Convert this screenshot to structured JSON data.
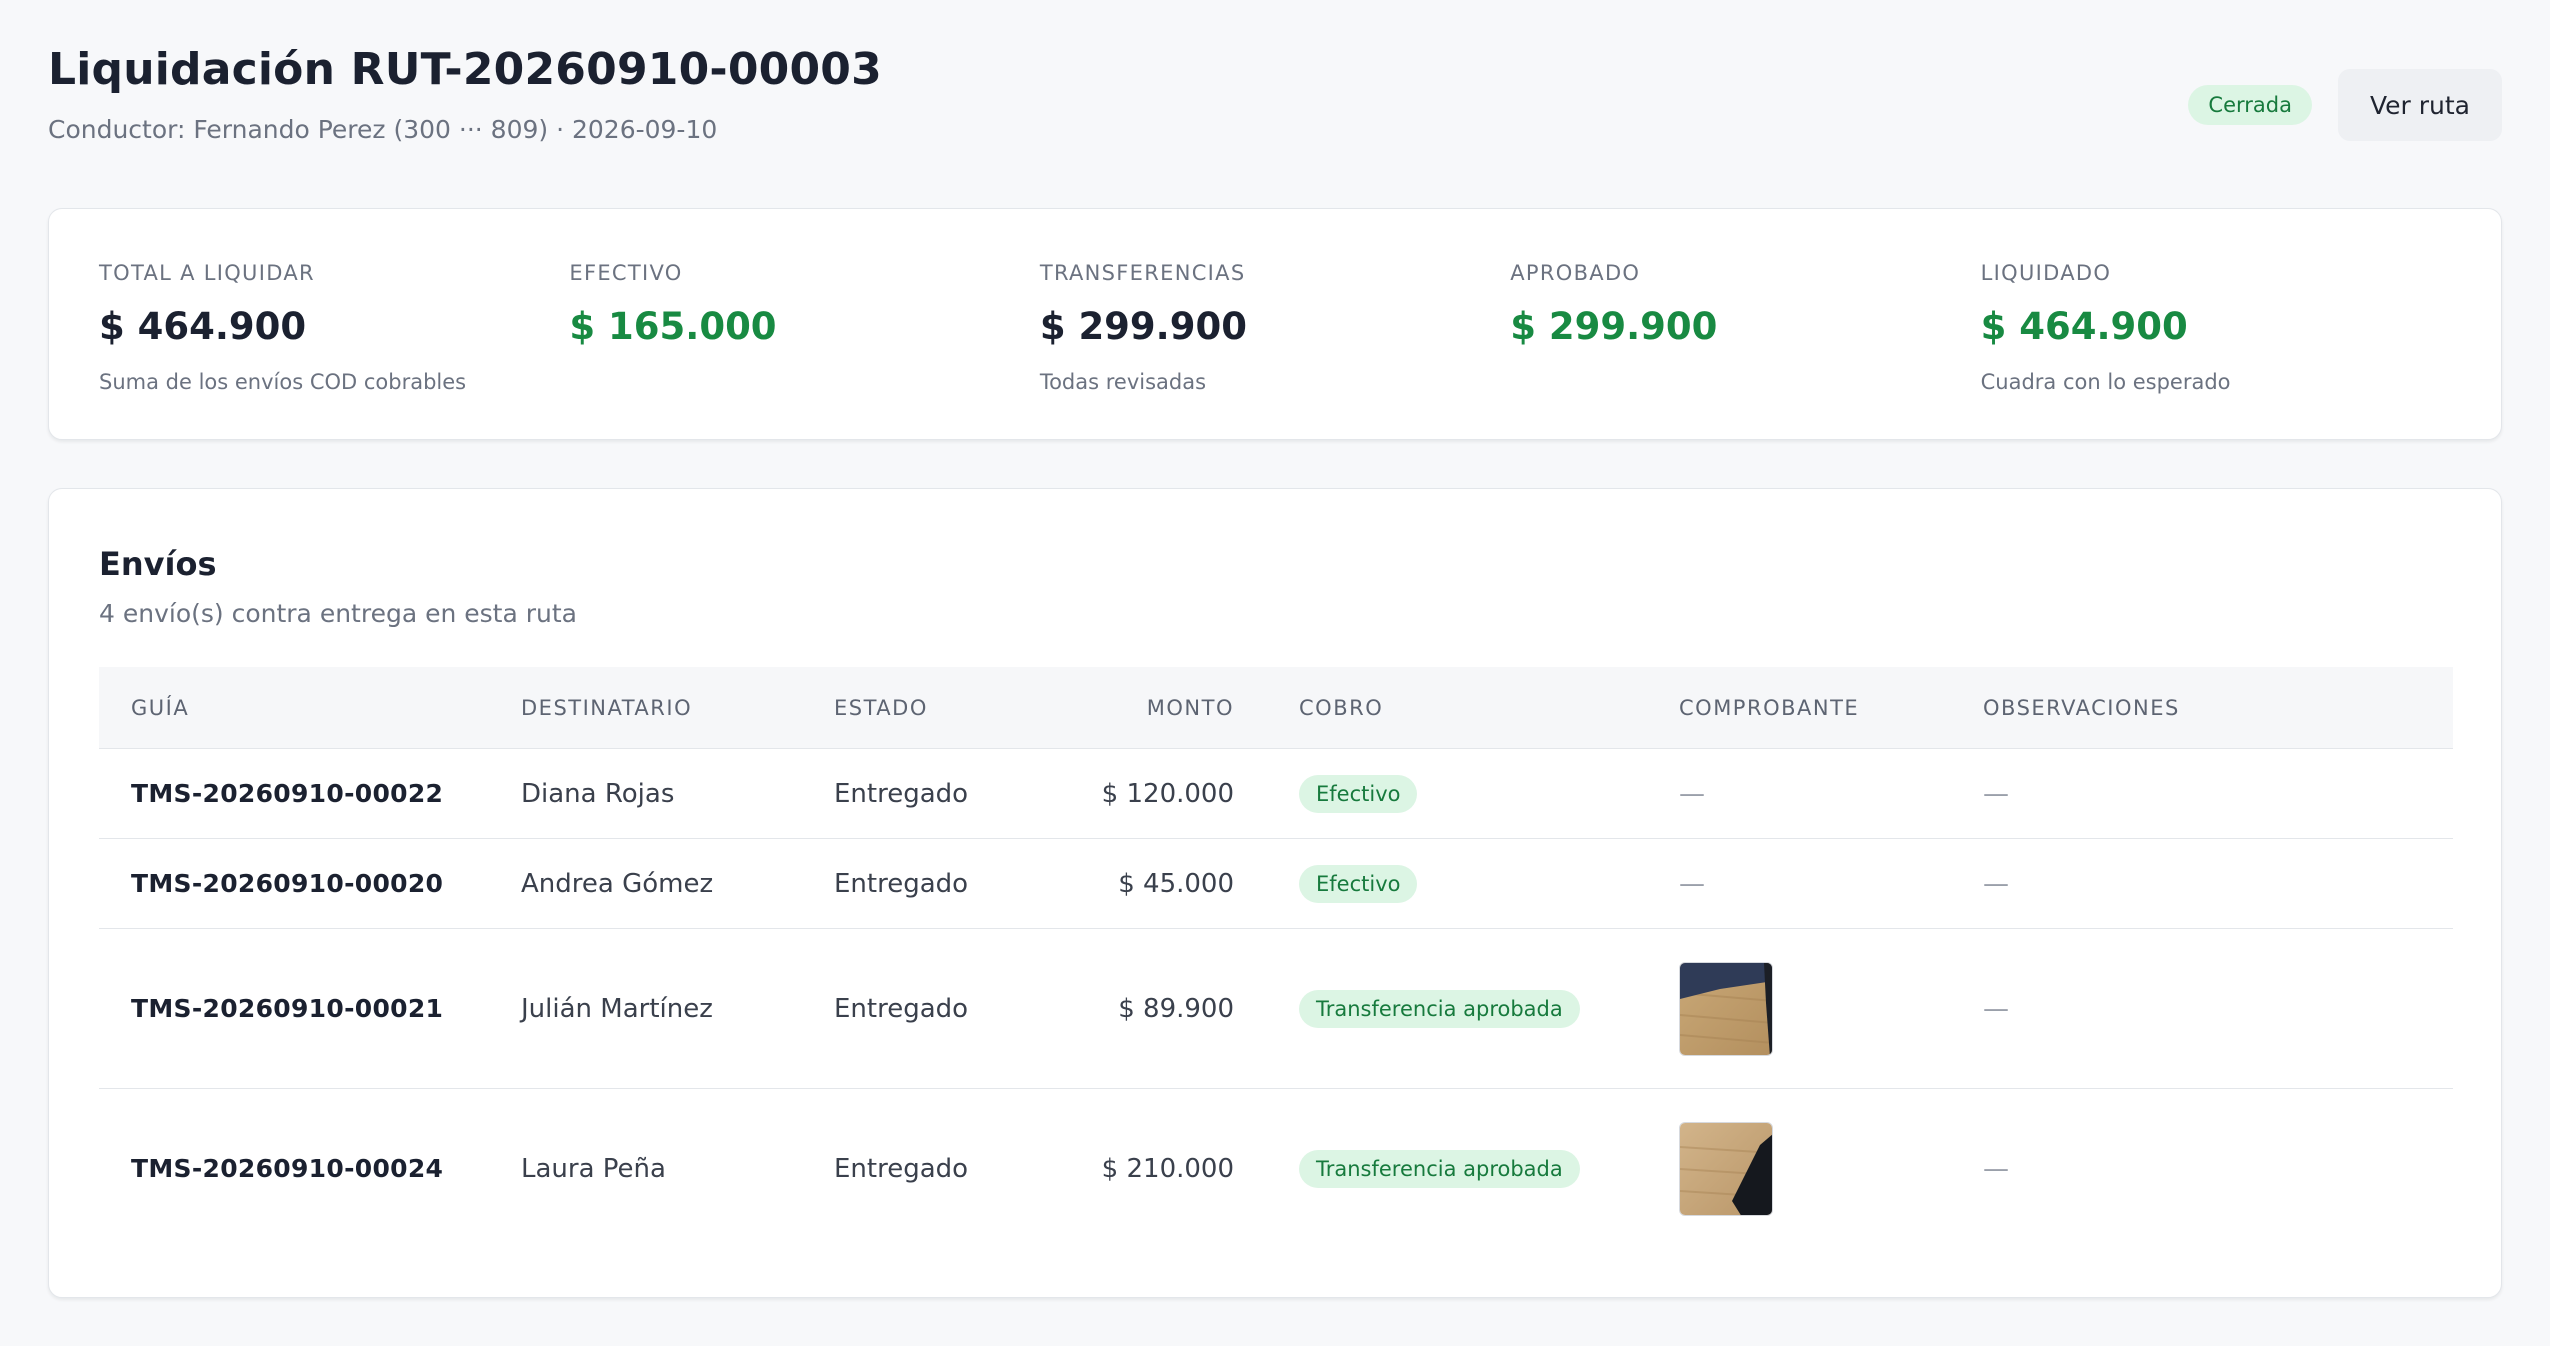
{
  "header": {
    "title": "Liquidación RUT-20260910-00003",
    "subtitle": "Conductor: Fernando Perez (300 ··· 809) · 2026-09-10",
    "status": "Cerrada",
    "action_button": "Ver ruta"
  },
  "summary": [
    {
      "label": "TOTAL A LIQUIDAR",
      "value": "$ 464.900",
      "note": "Suma de los envíos COD cobrables"
    },
    {
      "label": "EFECTIVO",
      "value": "$ 165.000",
      "note": ""
    },
    {
      "label": "TRANSFERENCIAS",
      "value": "$ 299.900",
      "note": "Todas revisadas"
    },
    {
      "label": "APROBADO",
      "value": "$ 299.900",
      "note": ""
    },
    {
      "label": "LIQUIDADO",
      "value": "$ 464.900",
      "note": "Cuadra con lo esperado"
    }
  ],
  "shipments": {
    "title": "Envíos",
    "subtitle": "4 envío(s) contra entrega en esta ruta",
    "columns": [
      "GUÍA",
      "DESTINATARIO",
      "ESTADO",
      "MONTO",
      "COBRO",
      "COMPROBANTE",
      "OBSERVACIONES"
    ],
    "rows": [
      {
        "guia": "TMS-20260910-00022",
        "destinatario": "Diana Rojas",
        "estado": "Entregado",
        "monto": "$ 120.000",
        "cobro": "Efectivo",
        "comprobante": "—",
        "observaciones": "—"
      },
      {
        "guia": "TMS-20260910-00020",
        "destinatario": "Andrea Gómez",
        "estado": "Entregado",
        "monto": "$ 45.000",
        "cobro": "Efectivo",
        "comprobante": "—",
        "observaciones": "—"
      },
      {
        "guia": "TMS-20260910-00021",
        "destinatario": "Julián Martínez",
        "estado": "Entregado",
        "monto": "$ 89.900",
        "cobro": "Transferencia aprobada",
        "comprobante": "",
        "observaciones": "—"
      },
      {
        "guia": "TMS-20260910-00024",
        "destinatario": "Laura Peña",
        "estado": "Entregado",
        "monto": "$ 210.000",
        "cobro": "Transferencia aprobada",
        "comprobante": "",
        "observaciones": "—"
      }
    ]
  },
  "colors": {
    "accent_green": "#188a42",
    "badge_bg": "#dcf5e4",
    "page_bg": "#f7f8fa"
  }
}
